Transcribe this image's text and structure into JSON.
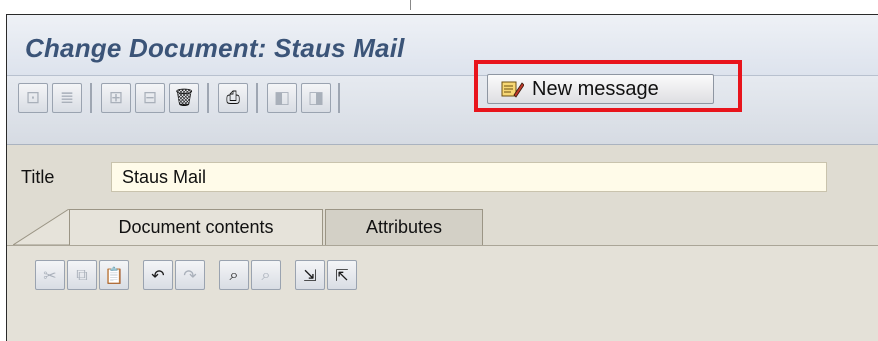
{
  "window": {
    "title": "Change Document: Staus Mail"
  },
  "app_toolbar": {
    "buttons": [
      {
        "icon": "display-icon",
        "glyph": "⊡",
        "enabled": false
      },
      {
        "icon": "structure-icon",
        "glyph": "≣",
        "enabled": false
      },
      {
        "icon": "hierarchy-icon",
        "glyph": "⊞",
        "enabled": false
      },
      {
        "icon": "distribution-icon",
        "glyph": "⊟",
        "enabled": false
      },
      {
        "icon": "trash-icon",
        "glyph": "🗑",
        "enabled": true
      },
      {
        "icon": "attach-icon",
        "glyph": "⎙",
        "enabled": true
      },
      {
        "icon": "previous-icon",
        "glyph": "◧",
        "enabled": false
      },
      {
        "icon": "next-icon",
        "glyph": "◨",
        "enabled": false
      }
    ],
    "new_message_label": "New message",
    "new_message_icon": "note-pencil-icon"
  },
  "form": {
    "title_label": "Title",
    "title_value": "Staus Mail"
  },
  "tabs": [
    {
      "label": "Document contents",
      "active": true
    },
    {
      "label": "Attributes",
      "active": false
    }
  ],
  "edit_toolbar": {
    "buttons": [
      {
        "icon": "cut-icon",
        "glyph": "✂",
        "enabled": false
      },
      {
        "icon": "copy-icon",
        "glyph": "⧉",
        "enabled": false
      },
      {
        "icon": "paste-icon",
        "glyph": "📋",
        "enabled": true
      },
      {
        "icon": "undo-icon",
        "glyph": "↶",
        "enabled": true
      },
      {
        "icon": "redo-icon",
        "glyph": "↷",
        "enabled": false
      },
      {
        "icon": "find-icon",
        "glyph": "⌕",
        "enabled": true
      },
      {
        "icon": "find-next-icon",
        "glyph": "⌕",
        "enabled": false
      },
      {
        "icon": "import-icon",
        "glyph": "⇲",
        "enabled": true
      },
      {
        "icon": "export-icon",
        "glyph": "⇱",
        "enabled": true
      }
    ]
  },
  "colors": {
    "title_text": "#3b5478",
    "highlight": "#e8141c",
    "input_bg": "#fffbe9"
  }
}
